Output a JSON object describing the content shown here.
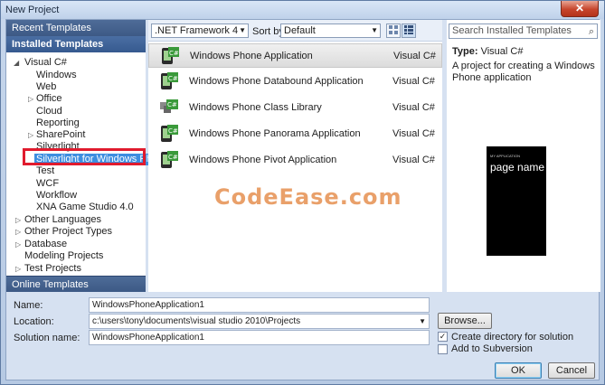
{
  "window": {
    "title": "New Project",
    "close_glyph": "✕"
  },
  "left": {
    "recent": "Recent Templates",
    "installed": "Installed Templates",
    "online": "Online Templates",
    "tree": [
      {
        "label": "Visual C#",
        "expander": "◢"
      },
      {
        "label": "Windows"
      },
      {
        "label": "Web"
      },
      {
        "label": "Office",
        "expander": "▷"
      },
      {
        "label": "Cloud"
      },
      {
        "label": "Reporting"
      },
      {
        "label": "SharePoint",
        "expander": "▷"
      },
      {
        "label": "Silverlight"
      },
      {
        "label": "Silverlight for Windows Phone",
        "selected": true
      },
      {
        "label": "Test"
      },
      {
        "label": "WCF"
      },
      {
        "label": "Workflow"
      },
      {
        "label": "XNA Game Studio 4.0"
      },
      {
        "label": "Other Languages",
        "expander": "▷"
      },
      {
        "label": "Other Project Types",
        "expander": "▷"
      },
      {
        "label": "Database",
        "expander": "▷"
      },
      {
        "label": "Modeling Projects"
      },
      {
        "label": "Test Projects",
        "expander": "▷"
      }
    ]
  },
  "toolbar": {
    "framework": ".NET Framework 4",
    "sort_label": "Sort by:",
    "sort_value": "Default"
  },
  "templates": [
    {
      "name": "Windows Phone Application",
      "lang": "Visual C#"
    },
    {
      "name": "Windows Phone Databound Application",
      "lang": "Visual C#"
    },
    {
      "name": "Windows Phone Class Library",
      "lang": "Visual C#"
    },
    {
      "name": "Windows Phone Panorama Application",
      "lang": "Visual C#"
    },
    {
      "name": "Windows Phone Pivot Application",
      "lang": "Visual C#"
    }
  ],
  "details": {
    "search_placeholder": "Search Installed Templates",
    "type_label": "Type:",
    "type_value": "Visual C#",
    "description": "A project for creating a Windows Phone application",
    "preview_app": "MY APPLICATION",
    "preview_title": "page name"
  },
  "watermark": "CodeEase.com",
  "form": {
    "name_label": "Name:",
    "name_value": "WindowsPhoneApplication1",
    "location_label": "Location:",
    "location_value": "c:\\users\\tony\\documents\\visual studio 2010\\Projects",
    "solution_label": "Solution name:",
    "solution_value": "WindowsPhoneApplication1",
    "browse": "Browse...",
    "create_dir": "Create directory for solution",
    "add_scm": "Add to Subversion",
    "ok": "OK",
    "cancel": "Cancel"
  },
  "colors": {
    "selection": "#3d8ee0",
    "highlight_box": "#e01b2e",
    "header_blue": "#3d5985"
  }
}
